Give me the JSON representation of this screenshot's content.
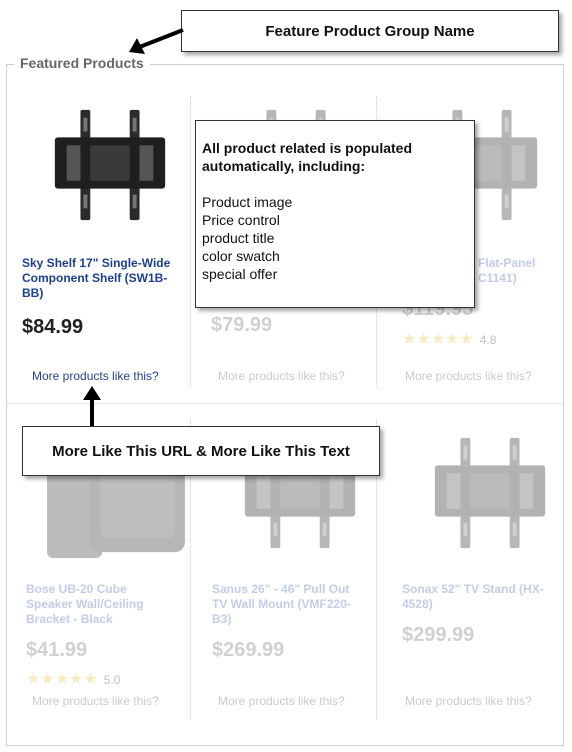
{
  "group": {
    "legend": "Featured Products"
  },
  "callouts": {
    "group_name": "Feature Product Group Name",
    "auto_populated_title": "All product related is populated automatically, including:",
    "auto_populated_items": [
      "Product image",
      "Price control",
      "product title",
      "color swatch",
      "special offer"
    ],
    "more_like_this": "More Like This URL & More Like This Text"
  },
  "products": [
    {
      "title": "Sky Shelf 17\" Single-Wide Component Shelf (SW1B-BB)",
      "price": "$84.99",
      "rating": "",
      "more_link": "More products like this?",
      "image_icon": "tv-wall-mount-icon"
    },
    {
      "title": "",
      "price": "$79.99",
      "rating": "",
      "more_link": "More products like this?",
      "image_icon": "tv-wall-mount-icon"
    },
    {
      "title": "Flat-Panel C1141)",
      "price": "$119.95",
      "rating": "4.8",
      "more_link": "More products like this?",
      "image_icon": "tv-wall-mount-icon"
    },
    {
      "title": "Bose UB-20 Cube Speaker Wall/Ceiling Bracket - Black",
      "price": "$41.99",
      "rating": "5.0",
      "more_link": "More products like this?",
      "image_icon": "speaker-bracket-icon"
    },
    {
      "title": "Sanus 26\" - 46\" Pull Out TV Wall Mount (VMF220-B3)",
      "price": "$269.99",
      "rating": "",
      "more_link": "More products like this?",
      "image_icon": "tv-wall-mount-icon"
    },
    {
      "title": "Sonax 52\" TV Stand (HX-4528)",
      "price": "$299.99",
      "rating": "",
      "more_link": "More products like this?",
      "image_icon": "tv-wall-mount-icon"
    }
  ],
  "colors": {
    "link_blue": "#1d3f8f",
    "star_gold": "#e8c84a",
    "frame_gray": "#cfcfcf"
  }
}
